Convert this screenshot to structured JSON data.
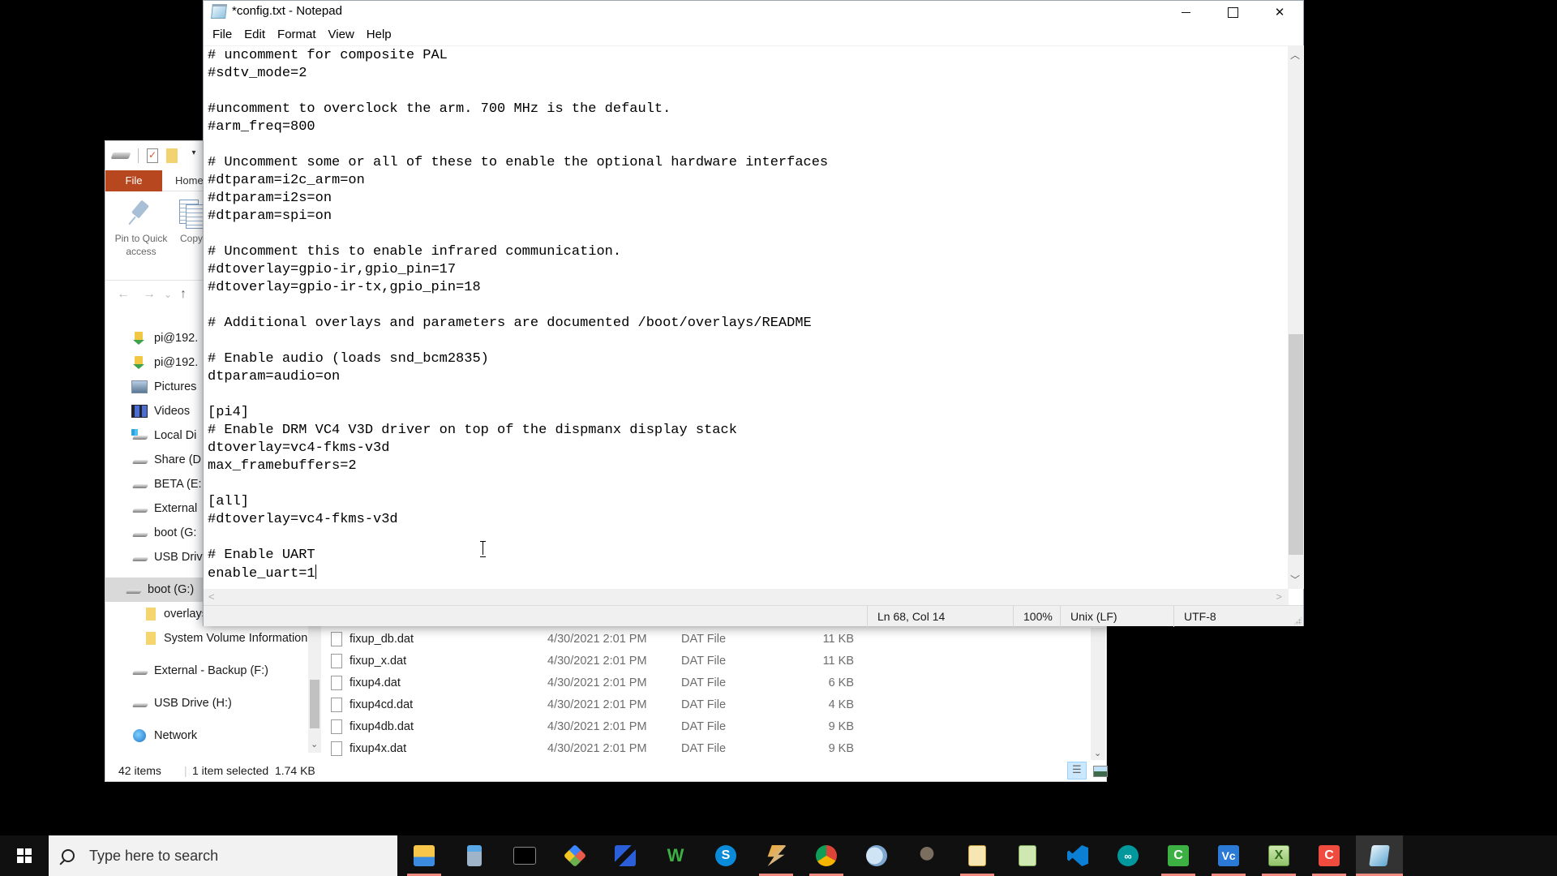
{
  "explorer": {
    "ribbon": {
      "file_tab": "File",
      "home_tab": "Home",
      "pin_label": "Pin to Quick access",
      "copy_label": "Copy"
    },
    "nav": {
      "back": "←",
      "forward": "→",
      "recent": "⌄",
      "up": "↑"
    },
    "sidebar": [
      {
        "label": "pi@192.",
        "icon": "network-folder-icon"
      },
      {
        "label": "pi@192.",
        "icon": "network-folder-icon"
      },
      {
        "label": "Pictures",
        "icon": "pictures-icon"
      },
      {
        "label": "Videos",
        "icon": "videos-icon"
      },
      {
        "label": "Local Di",
        "icon": "local-disk-icon"
      },
      {
        "label": "Share (D",
        "icon": "drive-icon"
      },
      {
        "label": "BETA (E:",
        "icon": "drive-icon"
      },
      {
        "label": "External",
        "icon": "drive-icon"
      },
      {
        "label": "boot (G:",
        "icon": "drive-icon"
      },
      {
        "label": "USB Driv",
        "icon": "drive-icon"
      },
      {
        "label": "boot (G:)",
        "icon": "drive-icon",
        "selected": true
      },
      {
        "label": "overlays",
        "icon": "folder-icon"
      },
      {
        "label": "System Volume Information",
        "icon": "folder-icon"
      },
      {
        "label": "External - Backup (F:)",
        "icon": "drive-icon"
      },
      {
        "label": "USB Drive (H:)",
        "icon": "drive-icon"
      },
      {
        "label": "Network",
        "icon": "network-icon"
      }
    ],
    "files": [
      {
        "name": "fixup_db.dat",
        "date": "4/30/2021 2:01 PM",
        "type": "DAT File",
        "size": "11 KB"
      },
      {
        "name": "fixup_x.dat",
        "date": "4/30/2021 2:01 PM",
        "type": "DAT File",
        "size": "11 KB"
      },
      {
        "name": "fixup4.dat",
        "date": "4/30/2021 2:01 PM",
        "type": "DAT File",
        "size": "6 KB"
      },
      {
        "name": "fixup4cd.dat",
        "date": "4/30/2021 2:01 PM",
        "type": "DAT File",
        "size": "4 KB"
      },
      {
        "name": "fixup4db.dat",
        "date": "4/30/2021 2:01 PM",
        "type": "DAT File",
        "size": "9 KB"
      },
      {
        "name": "fixup4x.dat",
        "date": "4/30/2021 2:01 PM",
        "type": "DAT File",
        "size": "9 KB"
      }
    ],
    "status": {
      "item_count": "42 items",
      "selection": "1 item selected  1.74 KB"
    }
  },
  "notepad": {
    "title": "*config.txt - Notepad",
    "menu": [
      "File",
      "Edit",
      "Format",
      "View",
      "Help"
    ],
    "lines": [
      "# uncomment for composite PAL",
      "#sdtv_mode=2",
      "",
      "#uncomment to overclock the arm. 700 MHz is the default.",
      "#arm_freq=800",
      "",
      "# Uncomment some or all of these to enable the optional hardware interfaces",
      "#dtparam=i2c_arm=on",
      "#dtparam=i2s=on",
      "#dtparam=spi=on",
      "",
      "# Uncomment this to enable infrared communication.",
      "#dtoverlay=gpio-ir,gpio_pin=17",
      "#dtoverlay=gpio-ir-tx,gpio_pin=18",
      "",
      "# Additional overlays and parameters are documented /boot/overlays/README",
      "",
      "# Enable audio (loads snd_bcm2835)",
      "dtparam=audio=on",
      "",
      "[pi4]",
      "# Enable DRM VC4 V3D driver on top of the dispmanx display stack",
      "dtoverlay=vc4-fkms-v3d",
      "max_framebuffers=2",
      "",
      "[all]",
      "#dtoverlay=vc4-fkms-v3d",
      "",
      "# Enable UART",
      "enable_uart=1"
    ],
    "vertical_scroll_position": 0.7,
    "status": {
      "position": "Ln 68, Col 14",
      "zoom": "100%",
      "line_ending": "Unix (LF)",
      "encoding": "UTF-8"
    }
  },
  "taskbar": {
    "search_placeholder": "Type here to search",
    "apps": [
      {
        "name": "File Explorer",
        "icon": "file-explorer-icon",
        "running": true,
        "glyph": ""
      },
      {
        "name": "Calculator",
        "icon": "calculator-icon",
        "running": false,
        "glyph": ""
      },
      {
        "name": "Command Prompt",
        "icon": "command-prompt-icon",
        "running": false,
        "glyph": ""
      },
      {
        "name": "Git",
        "icon": "git-icon",
        "running": false,
        "glyph": ""
      },
      {
        "name": "Network Connections",
        "icon": "network-connections-icon",
        "running": false,
        "glyph": ""
      },
      {
        "name": "W App",
        "icon": "w-app-icon",
        "running": false,
        "glyph": "W"
      },
      {
        "name": "Skype",
        "icon": "skype-icon",
        "running": false,
        "glyph": "S"
      },
      {
        "name": "Winamp",
        "icon": "winamp-icon",
        "running": true,
        "glyph": ""
      },
      {
        "name": "Chrome",
        "icon": "chrome-icon",
        "running": true,
        "glyph": ""
      },
      {
        "name": "Paint",
        "icon": "paint-icon",
        "running": false,
        "glyph": ""
      },
      {
        "name": "GIMP",
        "icon": "gimp-icon",
        "running": false,
        "glyph": ""
      },
      {
        "name": "Freeplane",
        "icon": "freeplane-icon",
        "running": true,
        "glyph": ""
      },
      {
        "name": "Notepad++",
        "icon": "notepadpp-icon",
        "running": false,
        "glyph": ""
      },
      {
        "name": "Visual Studio Code",
        "icon": "vscode-icon",
        "running": false,
        "glyph": ""
      },
      {
        "name": "Arduino",
        "icon": "arduino-icon",
        "running": false,
        "glyph": "∞"
      },
      {
        "name": "Camtasia",
        "icon": "camtasia-icon",
        "running": true,
        "glyph": "C"
      },
      {
        "name": "VNC Viewer",
        "icon": "vnc-icon",
        "running": true,
        "glyph": "Vc"
      },
      {
        "name": "Excel",
        "icon": "excel-icon",
        "running": true,
        "glyph": "X"
      },
      {
        "name": "Camtasia Recorder",
        "icon": "camtasia-recorder-icon",
        "running": true,
        "glyph": "C"
      },
      {
        "name": "Notepad",
        "icon": "notepad-icon",
        "running": true,
        "active": true,
        "glyph": ""
      }
    ]
  }
}
